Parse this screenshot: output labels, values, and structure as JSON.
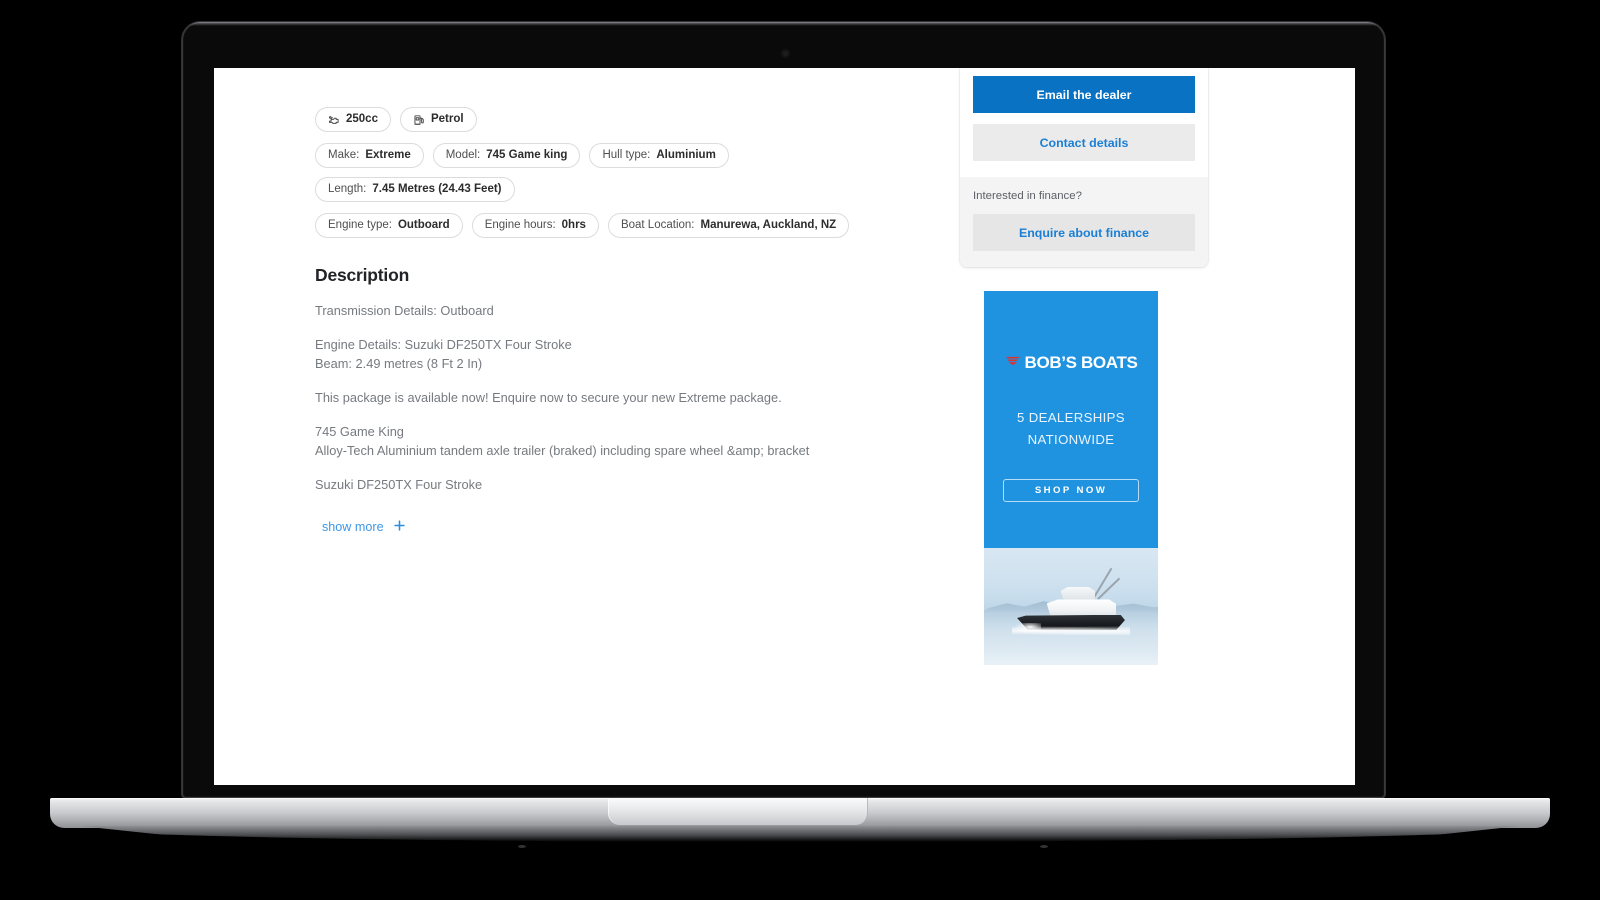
{
  "device": {
    "type": "laptop-mockup",
    "webcam": "webcam-dot"
  },
  "listing": {
    "spec_chips": [
      {
        "icon": "engine-icon",
        "value": "250cc"
      },
      {
        "icon": "fuel-pump-icon",
        "value": "Petrol"
      }
    ],
    "detail_chips_row1": [
      {
        "key": "Make:",
        "value": "Extreme"
      },
      {
        "key": "Model:",
        "value": "745 Game king"
      },
      {
        "key": "Hull type:",
        "value": "Aluminium"
      },
      {
        "key": "Length:",
        "value": "7.45 Metres (24.43 Feet)"
      }
    ],
    "detail_chips_row2": [
      {
        "key": "Engine type:",
        "value": "Outboard"
      },
      {
        "key": "Engine hours:",
        "value": "0hrs"
      },
      {
        "key": "Boat Location:",
        "value": "Manurewa, Auckland, NZ"
      }
    ],
    "description": {
      "heading": "Description",
      "paragraphs": [
        "Transmission Details: Outboard",
        "Engine Details: Suzuki DF250TX Four Stroke\nBeam: 2.49 metres (8 Ft 2 In)",
        "This package is available now! Enquire now to secure your new Extreme package.",
        "745 Game King\nAlloy-Tech Aluminium tandem axle trailer (braked) including spare wheel &amp; bracket",
        "Suzuki DF250TX Four Stroke"
      ],
      "show_more_label": "show more",
      "show_more_icon": "plus-icon"
    }
  },
  "sidebar": {
    "email_dealer_label": "Email the dealer",
    "contact_details_label": "Contact details",
    "finance_question": "Interested in finance?",
    "enquire_finance_label": "Enquire about finance"
  },
  "advertisement": {
    "logo_mark": "red-swoosh-icon",
    "brand": "BOB’S BOATS",
    "tagline_line1": "5 DEALERSHIPS",
    "tagline_line2": "NATIONWIDE",
    "cta_label": "SHOP NOW",
    "photo_alt": "motor-yacht-on-water-photo"
  },
  "colors": {
    "primary_button": "#0a72c2",
    "link_blue": "#1a7fd4",
    "ad_background": "#1f93e0",
    "logo_red": "#d93333",
    "chip_border": "#dcdcdc",
    "body_text": "#767a7f",
    "heading_text": "#222326",
    "panel_grey": "#f4f4f4"
  }
}
